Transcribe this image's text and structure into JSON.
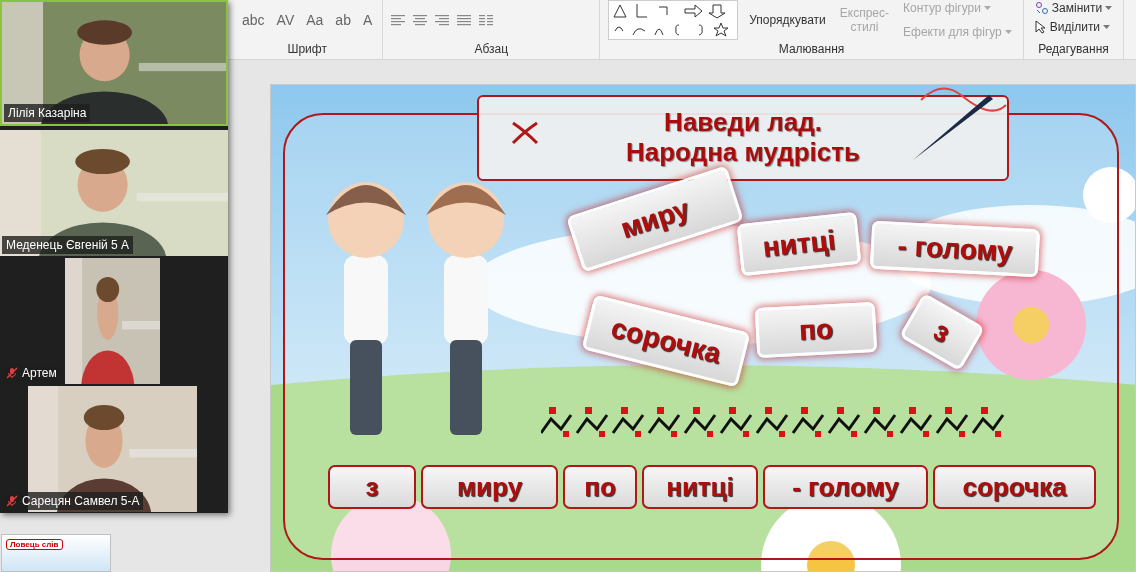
{
  "ribbon": {
    "font_buttons": [
      {
        "label": "abc"
      },
      {
        "label": "AV"
      },
      {
        "label": "Aa"
      },
      {
        "label": "ab"
      },
      {
        "label": "A"
      }
    ],
    "groups": [
      {
        "label": "Шрифт"
      },
      {
        "label": "Абзац"
      },
      {
        "label": "Малювання"
      },
      {
        "label": "Редагування"
      }
    ],
    "drawing_buttons": [
      {
        "label": "Упорядкувати",
        "disabled": false
      },
      {
        "label": "Експрес-\nстилі",
        "disabled": true
      }
    ],
    "shape_buttons": [
      {
        "label": "Контур фігури",
        "disabled": true
      },
      {
        "label": "Ефекти для фігур",
        "disabled": true
      }
    ],
    "edit_buttons": [
      {
        "label": "Замінити",
        "kind": "replace"
      },
      {
        "label": "Виділити",
        "kind": "select"
      }
    ]
  },
  "thumbnail": {
    "title": "Ловець слів"
  },
  "video_panel": {
    "participants": [
      {
        "name": "Лілія Казаріна",
        "muted": false,
        "speaking": true
      },
      {
        "name": "Меденець Євгеній 5 А",
        "muted": false,
        "speaking": false
      },
      {
        "name": "Артем",
        "muted": true,
        "speaking": false
      },
      {
        "name": "Сарецян Самвел 5-А",
        "muted": true,
        "speaking": false
      }
    ]
  },
  "slide": {
    "title_lines": [
      "Наведи лад.",
      "Народна мудрість"
    ],
    "scattered_words": [
      {
        "text": "миру"
      },
      {
        "text": "нитці"
      },
      {
        "text": "- голому"
      },
      {
        "text": "сорочка"
      },
      {
        "text": "по"
      },
      {
        "text": "з"
      }
    ],
    "answer_words": [
      {
        "text": "з"
      },
      {
        "text": "миру"
      },
      {
        "text": "по"
      },
      {
        "text": "нитці"
      },
      {
        "text": "- голому"
      },
      {
        "text": "сорочка"
      }
    ]
  }
}
